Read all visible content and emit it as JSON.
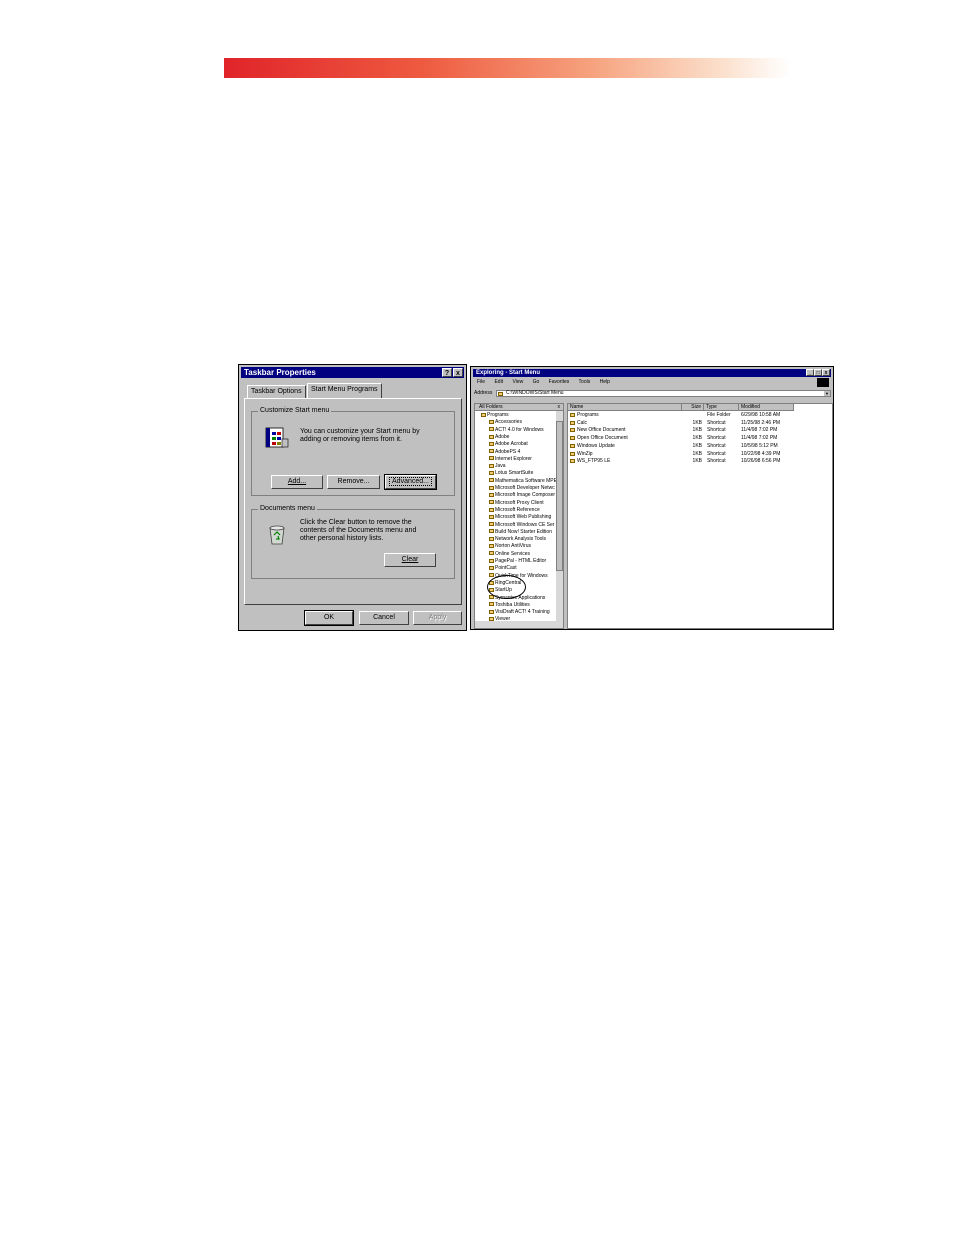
{
  "taskbar_dialog": {
    "title": "Taskbar Properties",
    "help_btn": "?",
    "close_btn": "x",
    "tabs": [
      "Taskbar Options",
      "Start Menu Programs"
    ],
    "customize_group": {
      "label": "Customize Start menu",
      "text": "You can customize your Start menu by adding or removing items from it.",
      "buttons": {
        "add": "Add...",
        "remove": "Remove...",
        "advanced": "Advanced..."
      }
    },
    "documents_group": {
      "label": "Documents menu",
      "text": "Click the Clear button to remove the contents of the Documents menu and other personal history lists.",
      "clear": "Clear"
    },
    "footer": {
      "ok": "OK",
      "cancel": "Cancel",
      "apply": "Apply"
    }
  },
  "explorer": {
    "title": "Exploring - Start Menu",
    "menu": [
      "File",
      "Edit",
      "View",
      "Go",
      "Favorites",
      "Tools",
      "Help"
    ],
    "address_label": "Address",
    "address_value": "C:\\WINDOWS\\Start Menu",
    "tree_header": "All Folders",
    "tree_items": [
      "Programs",
      "Accessories",
      "ACT! 4.0 for Windows",
      "Adobe",
      "Adobe Acrobat",
      "AdobePS 4",
      "Internet Explorer",
      "Java",
      "Lotus SmartSuite",
      "Mathematica Software MPE",
      "Microsoft Developer Netwc",
      "Microsoft Image Composer",
      "Microsoft Proxy Client",
      "Microsoft Reference",
      "Microsoft Web Publishing",
      "Microsoft Windows CE Ser",
      "Build Now! Starter Edition",
      "Network Analysis Tools",
      "Norton AntiVirus",
      "Online Services",
      "PagePal - HTML Editor",
      "PointCast",
      "QuickTime for Windows",
      "RingCentral",
      "StartUp",
      "Symantec Applications",
      "Toshiba Utilities",
      "VisiDraft ACT! 4 Training",
      "Viewer"
    ],
    "columns": [
      "Name",
      "Size",
      "Type",
      "Modified"
    ],
    "rows": [
      {
        "name": "Programs",
        "size": "",
        "type": "File Folder",
        "modified": "6/29/98 10:58 AM"
      },
      {
        "name": "Calc",
        "size": "1KB",
        "type": "Shortcut",
        "modified": "11/25/98 2:46 PM"
      },
      {
        "name": "New Office Document",
        "size": "1KB",
        "type": "Shortcut",
        "modified": "11/4/98 7:02 PM"
      },
      {
        "name": "Open Office Document",
        "size": "1KB",
        "type": "Shortcut",
        "modified": "11/4/98 7:02 PM"
      },
      {
        "name": "Windows Update",
        "size": "1KB",
        "type": "Shortcut",
        "modified": "10/5/98 5:12 PM"
      },
      {
        "name": "WinZip",
        "size": "1KB",
        "type": "Shortcut",
        "modified": "10/22/98 4:39 PM"
      },
      {
        "name": "WS_FTP95 LE",
        "size": "1KB",
        "type": "Shortcut",
        "modified": "10/26/98 6:56 PM"
      }
    ]
  },
  "colors": {
    "titlebar": "#000080",
    "face": "#c0c0c0",
    "banner_start": "#e0242a"
  }
}
